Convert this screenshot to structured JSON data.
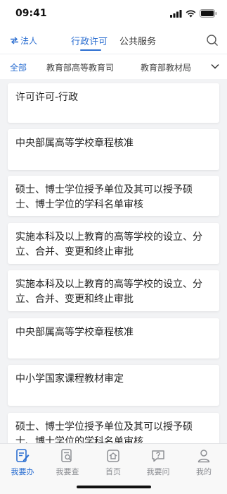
{
  "status": {
    "time": "09:41"
  },
  "nav": {
    "role_label": "法人",
    "tabs": [
      "行政许可",
      "公共服务"
    ],
    "active_tab": 0
  },
  "filters": {
    "items": [
      "全部",
      "教育部高等教育司",
      "教育部教材局"
    ],
    "active": 0
  },
  "list": [
    "许可许可-行政",
    "中央部属高等学校章程核准",
    "硕士、博士学位授予单位及其可以授予硕士、博士学位的学科名单审核",
    "实施本科及以上教育的高等学校的设立、分立、合并、变更和终止审批",
    "实施本科及以上教育的高等学校的设立、分立、合并、变更和终止审批",
    "中央部属高等学校章程核准",
    "中小学国家课程教材审定",
    "硕士、博士学位授予单位及其可以授予硕士、博士学位的学科名单审核"
  ],
  "tabbar": {
    "items": [
      {
        "label": "我要办",
        "icon": "edit-doc-icon"
      },
      {
        "label": "我要查",
        "icon": "search-doc-icon"
      },
      {
        "label": "首页",
        "icon": "home-icon"
      },
      {
        "label": "我要问",
        "icon": "question-chat-icon"
      },
      {
        "label": "我的",
        "icon": "user-icon"
      }
    ],
    "active": 0
  },
  "colors": {
    "accent": "#2c6fd1",
    "inactive": "#8d8f94"
  }
}
